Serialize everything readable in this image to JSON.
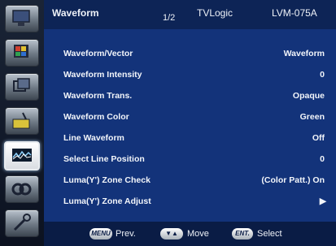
{
  "header": {
    "menu_title": "Waveform",
    "page": "1/2",
    "brand": "TVLogic",
    "model": "LVM-075A"
  },
  "menu_items": [
    {
      "label": "Waveform/Vector",
      "value": "Waveform"
    },
    {
      "label": "Waveform Intensity",
      "value": "0"
    },
    {
      "label": "Waveform Trans.",
      "value": "Opaque"
    },
    {
      "label": "Waveform Color",
      "value": "Green"
    },
    {
      "label": "Line Waveform",
      "value": "Off"
    },
    {
      "label": "Select Line Position",
      "value": "0"
    },
    {
      "label": "Luma(Y') Zone Check",
      "value": "(Color Patt.) On"
    },
    {
      "label": "Luma(Y') Zone Adjust",
      "value": "▶"
    }
  ],
  "sidebar": {
    "items": [
      {
        "name": "monitor-icon"
      },
      {
        "name": "color-icon"
      },
      {
        "name": "display-icon"
      },
      {
        "name": "audio-icon"
      },
      {
        "name": "waveform-icon",
        "active": true
      },
      {
        "name": "link-icon"
      },
      {
        "name": "tools-icon"
      }
    ]
  },
  "footer": {
    "prev_key": "MENU",
    "prev_label": "Prev.",
    "move_key": "▼▲",
    "move_label": "Move",
    "select_key": "ENT.",
    "select_label": "Select"
  }
}
